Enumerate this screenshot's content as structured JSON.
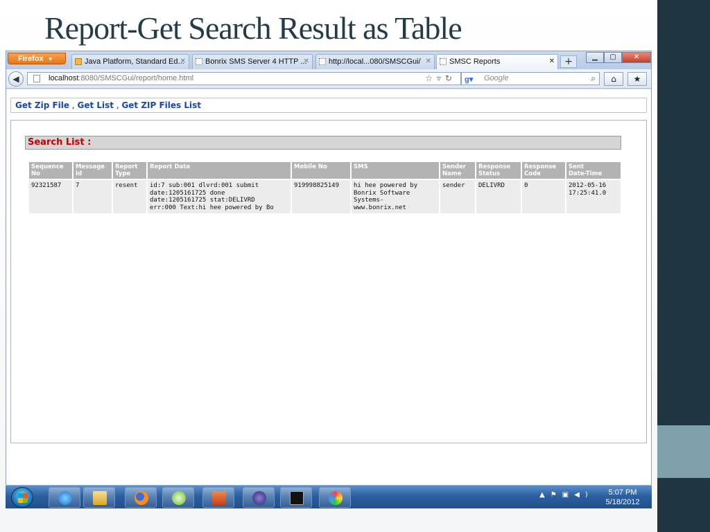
{
  "slide": {
    "title": "Report-Get Search Result as Table",
    "colors": {
      "title": "#243c49",
      "right_band": "#1f3642",
      "accent": "#7fa1ab"
    }
  },
  "browser": {
    "app_menu_label": "Firefox",
    "tabs": [
      {
        "label": "Java Platform, Standard Ed...",
        "icon": "java-icon"
      },
      {
        "label": "Bonrix SMS Server 4 HTTP ...",
        "icon": "blank-page-icon"
      },
      {
        "label": "http://local...080/SMSCGui/",
        "icon": "blank-page-icon"
      },
      {
        "label": "SMSC Reports",
        "icon": "blank-page-icon",
        "active": true
      }
    ],
    "url_host": "localhost",
    "url_rest": ":8080/SMSCGui/report/home.html",
    "search_placeholder": "Google"
  },
  "page": {
    "links": [
      "Get Zip File",
      "Get List",
      "Get ZIP Files List"
    ],
    "link_separator": ",",
    "heading": "Search List :",
    "table": {
      "headers": [
        [
          "Sequence",
          "No"
        ],
        [
          "Message",
          "Id"
        ],
        [
          "Report",
          "Type"
        ],
        [
          "Report Data",
          ""
        ],
        [
          "Mobile No",
          ""
        ],
        [
          "SMS",
          ""
        ],
        [
          "Sender",
          "Name"
        ],
        [
          "Response",
          "Status"
        ],
        [
          "Response",
          "Code"
        ],
        [
          "Sent",
          "Date-Time"
        ]
      ],
      "rows": [
        {
          "sequence_no": "92321587",
          "message_id": "7",
          "report_type": "resent",
          "report_data": [
            "id:7 sub:001 dlvrd:001 submit",
            "date:1205161725 done",
            "date:1205161725 stat:DELIVRD",
            "err:000 Text:hi hee powered by Bo"
          ],
          "mobile_no": "919998825149",
          "sms": [
            "hi hee powered by",
            "Bonrix Software",
            "Systems-",
            "www.bonrix.net"
          ],
          "sender_name": "sender",
          "response_status": "DELIVRD",
          "response_code": "0",
          "sent_datetime": [
            "2012-05-16",
            "17:25:41.0"
          ]
        }
      ]
    },
    "colors": {
      "link": "#1a47a8",
      "heading_text": "#c00000",
      "header_bg": "#b3b3b3",
      "cell_bg": "#ececec"
    }
  },
  "taskbar": {
    "time": "5:07 PM",
    "date": "5/18/2012",
    "pinned": [
      "ie-icon",
      "explorer-icon",
      "firefox-icon",
      "talk-icon",
      "powerpoint-icon",
      "eclipse-icon",
      "cmd-icon",
      "paint-icon"
    ]
  }
}
